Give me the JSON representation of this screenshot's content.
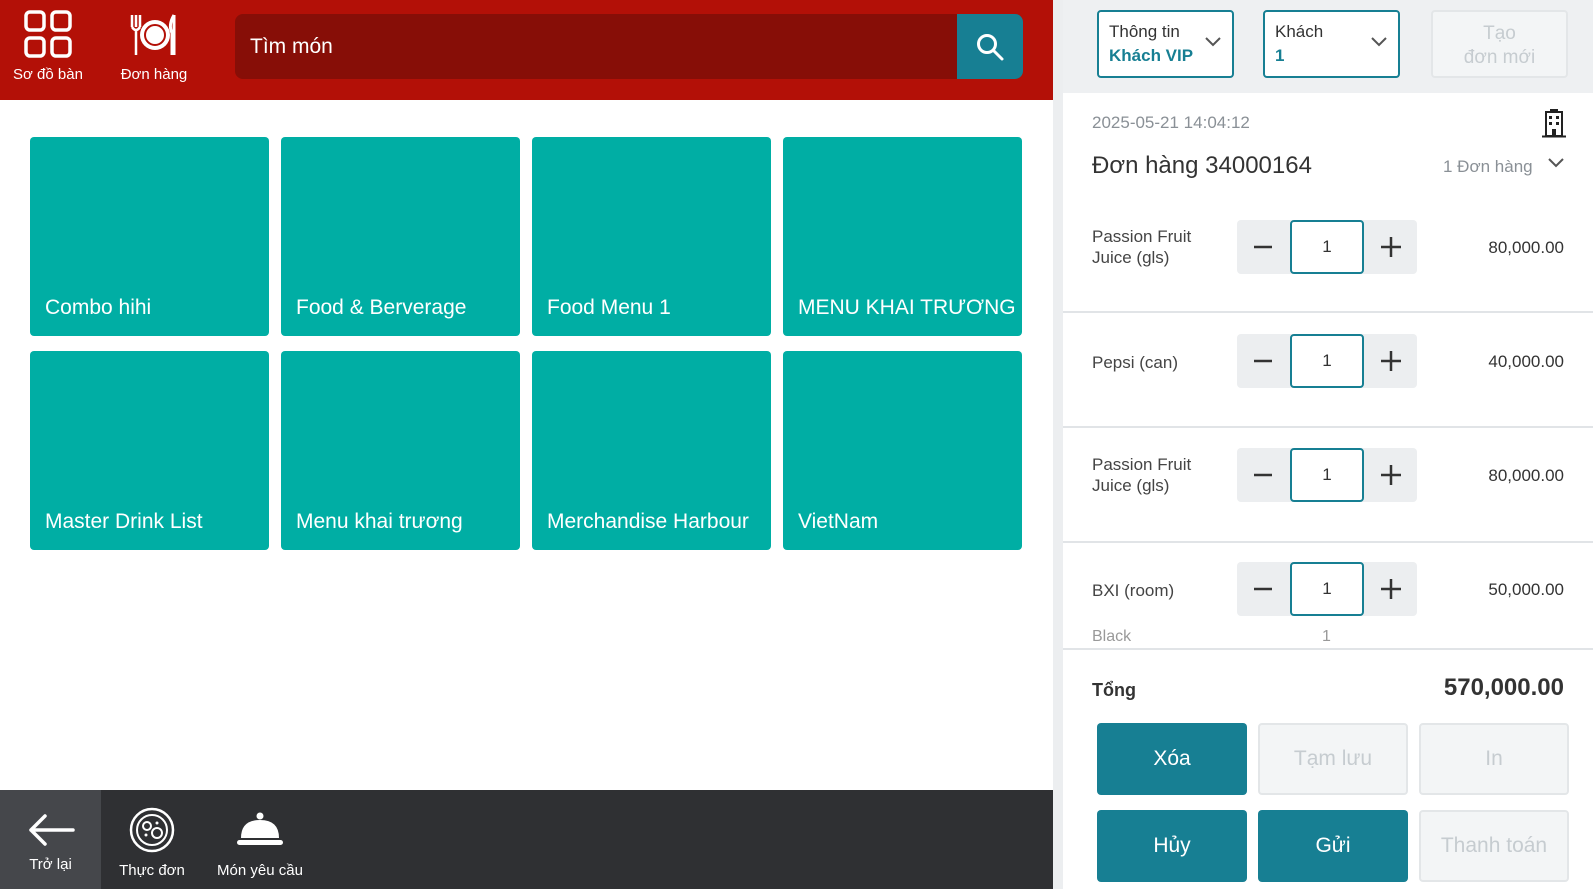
{
  "topnav": {
    "tables": "Sơ đồ bàn",
    "orders": "Đơn hàng"
  },
  "search": {
    "placeholder": "Tìm món"
  },
  "categories": [
    "Combo hihi",
    "Food & Berverage",
    "Food Menu 1",
    "MENU KHAI TRƯƠNG",
    "Master Drink List",
    "Menu khai trương",
    "Merchandise Harbour",
    "VietNam"
  ],
  "bottomnav": {
    "back": "Trở lại",
    "menu": "Thực đơn",
    "request": "Món yêu cầu"
  },
  "header": {
    "info_label": "Thông tin",
    "info_value": "Khách VIP",
    "guest_label": "Khách",
    "guest_value": "1",
    "new_order_line1": "Tạo",
    "new_order_line2": "đơn mới"
  },
  "order": {
    "datetime": "2025-05-21 14:04:12",
    "title": "Đơn hàng 34000164",
    "count": "1 Đơn hàng",
    "items": [
      {
        "name": "Passion Fruit Juice (gls)",
        "qty": "1",
        "price": "80,000.00"
      },
      {
        "name": "Pepsi (can)",
        "qty": "1",
        "price": "40,000.00"
      },
      {
        "name": "Passion Fruit Juice (gls)",
        "qty": "1",
        "price": "80,000.00"
      },
      {
        "name": "BXI (room)",
        "qty": "1",
        "price": "50,000.00"
      }
    ],
    "sub_item": {
      "name": "Black",
      "qty": "1"
    },
    "total_label": "Tổng",
    "total_value": "570,000.00"
  },
  "actions": {
    "delete": "Xóa",
    "hold": "Tạm lưu",
    "print": "In",
    "cancel": "Hủy",
    "send": "Gửi",
    "pay": "Thanh toán"
  },
  "colors": {
    "brand_red": "#b31007",
    "search_dark": "#870e07",
    "teal_tile": "#00aea4",
    "primary": "#177f93",
    "bottom_bar": "#2f3033"
  }
}
